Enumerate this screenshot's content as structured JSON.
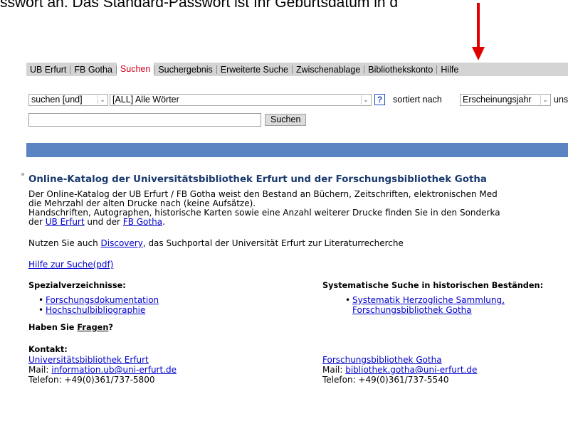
{
  "instruction": "sswort an. Das Standard-Passwort ist Ihr Geburtsdatum in d",
  "nav": {
    "items": [
      "UB Erfurt",
      "FB Gotha",
      "Suchen",
      "Suchergebnis",
      "Erweiterte Suche",
      "Zwischenablage",
      "Bibliothekskonto",
      "Hilfe"
    ],
    "active": "Suchen"
  },
  "search": {
    "operator_value": "suchen [und]",
    "field_value": "[ALL] Alle Wörter",
    "help_label": "?",
    "sort_label": "sortiert nach",
    "sort_value": "Erscheinungsjahr",
    "trailing_label": "uns",
    "query_value": "",
    "submit_label": "Suchen"
  },
  "intro": {
    "heading": "Online-Katalog der Universitätsbibliothek Erfurt und der Forschungsbibliothek Gotha",
    "line1": "Der Online-Katalog der UB Erfurt / FB Gotha weist den Bestand an Büchern, Zeitschriften, elektronischen Med",
    "line2": "die Mehrzahl der alten Drucke nach (keine Aufsätze).",
    "line3": "Handschriften, Autographen, historische Karten sowie eine Anzahl weiterer Drucke finden Sie in den Sonderka",
    "line4_pre": "der ",
    "line4_link1": "UB Erfurt",
    "line4_mid": " und der ",
    "line4_link2": "FB Gotha",
    "line4_post": ".",
    "discovery_pre": "Nutzen Sie auch ",
    "discovery_link": "Discovery",
    "discovery_post": ", das Suchportal der Universität Erfurt zur Literaturrecherche",
    "help_pdf": "Hilfe zur Suche(pdf)"
  },
  "special": {
    "title": "Spezialverzeichnisse:",
    "items": [
      "Forschungsdokumentation",
      "Hochschulbibliographie"
    ]
  },
  "systematic": {
    "title": "Systematische Suche in historischen Beständen:",
    "item_line1": "Systematik Herzogliche Sammlung,",
    "item_line2": "Forschungsbibliothek Gotha"
  },
  "questions": {
    "pre": "Haben Sie ",
    "link": "Fragen",
    "post": "?"
  },
  "contact": {
    "title": "Kontakt:",
    "left": {
      "name": "Universitätsbibliothek Erfurt",
      "mail_label": "Mail: ",
      "mail": "information.ub@uni-erfurt.de",
      "phone": "Telefon: +49(0)361/737-5800"
    },
    "right": {
      "name": "Forschungsbibliothek Gotha",
      "mail_label": "Mail: ",
      "mail": "bibliothek.gotha@uni-erfurt.de",
      "phone": "Telefon: +49(0)361/737-5540"
    }
  },
  "colors": {
    "active_tab": "#d0021b",
    "navbar_bg": "#d4d4d4",
    "blue_bar": "#5b84c2",
    "link": "#0000cc",
    "arrow": "#e00000"
  }
}
